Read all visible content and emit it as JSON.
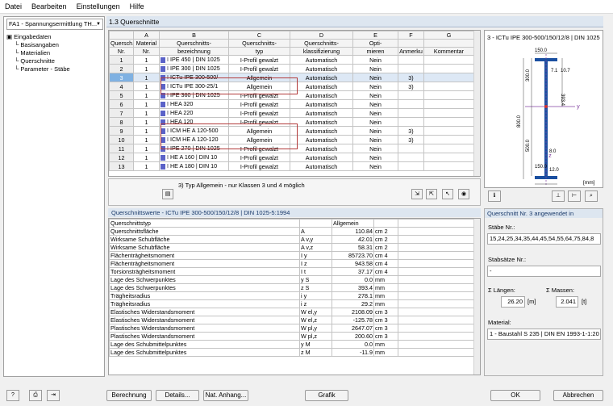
{
  "menu": [
    "Datei",
    "Bearbeiten",
    "Einstellungen",
    "Hilfe"
  ],
  "module_select": "FA1 - Spannungsermittlung TH...",
  "tree": [
    {
      "label": "Eingabedaten",
      "level": 0
    },
    {
      "label": "Basisangaben",
      "level": 1
    },
    {
      "label": "Materialien",
      "level": 1
    },
    {
      "label": "Querschnitte",
      "level": 1
    },
    {
      "label": "Parameter - Stäbe",
      "level": 1
    }
  ],
  "panel_title": "1.3 Querschnitte",
  "grid": {
    "letters": [
      "",
      "A",
      "B",
      "C",
      "D",
      "E",
      "F",
      "G"
    ],
    "headers": [
      [
        "Quersch.",
        "Nr."
      ],
      [
        "Material",
        "Nr."
      ],
      [
        "Querschnitts-",
        "bezeichnung"
      ],
      [
        "Querschnitts-",
        "typ"
      ],
      [
        "Querschnitts-",
        "klassifizierung"
      ],
      [
        "Opti-",
        "mieren"
      ],
      [
        "",
        "Anmerku"
      ],
      [
        "",
        "Kommentar"
      ]
    ],
    "rows": [
      {
        "nr": "1",
        "mat": "1",
        "name": "IPE 450 | DIN 1025",
        "typ": "I-Profil gewalzt",
        "kl": "Automatisch",
        "opt": "Nein",
        "anm": ""
      },
      {
        "nr": "2",
        "mat": "1",
        "name": "IPE 300 | DIN 1025",
        "typ": "I-Profil gewalzt",
        "kl": "Automatisch",
        "opt": "Nein",
        "anm": ""
      },
      {
        "nr": "3",
        "mat": "1",
        "name": "ICTu IPE 300-500/",
        "typ": "Allgemein",
        "kl": "Automatisch",
        "opt": "Nein",
        "anm": "3)"
      },
      {
        "nr": "4",
        "mat": "1",
        "name": "ICTu IPE 300-25/1",
        "typ": "Allgemein",
        "kl": "Automatisch",
        "opt": "Nein",
        "anm": "3)"
      },
      {
        "nr": "5",
        "mat": "1",
        "name": "IPE 360 | DIN 1025",
        "typ": "I-Profil gewalzt",
        "kl": "Automatisch",
        "opt": "Nein",
        "anm": ""
      },
      {
        "nr": "6",
        "mat": "1",
        "name": "HEA 320",
        "typ": "I-Profil gewalzt",
        "kl": "Automatisch",
        "opt": "Nein",
        "anm": ""
      },
      {
        "nr": "7",
        "mat": "1",
        "name": "HEA 220",
        "typ": "I-Profil gewalzt",
        "kl": "Automatisch",
        "opt": "Nein",
        "anm": ""
      },
      {
        "nr": "8",
        "mat": "1",
        "name": "HEA 120",
        "typ": "I-Profil gewalzt",
        "kl": "Automatisch",
        "opt": "Nein",
        "anm": ""
      },
      {
        "nr": "9",
        "mat": "1",
        "name": "ICM HE A 120-500",
        "typ": "Allgemein",
        "kl": "Automatisch",
        "opt": "Nein",
        "anm": "3)"
      },
      {
        "nr": "10",
        "mat": "1",
        "name": "ICM HE A 120-120",
        "typ": "Allgemein",
        "kl": "Automatisch",
        "opt": "Nein",
        "anm": "3)"
      },
      {
        "nr": "11",
        "mat": "1",
        "name": "IPE 270 | DIN 1025",
        "typ": "I-Profil gewalzt",
        "kl": "Automatisch",
        "opt": "Nein",
        "anm": ""
      },
      {
        "nr": "12",
        "mat": "1",
        "name": "HE A 160 | DIN 10",
        "typ": "I-Profil gewalzt",
        "kl": "Automatisch",
        "opt": "Nein",
        "anm": ""
      },
      {
        "nr": "13",
        "mat": "1",
        "name": "HE A 180 | DIN 10",
        "typ": "I-Profil gewalzt",
        "kl": "Automatisch",
        "opt": "Nein",
        "anm": ""
      }
    ]
  },
  "note": "3) Typ Allgemein - nur Klassen 3 und 4 möglich",
  "values_title": "Querschnittswerte  -  ICTu IPE 300-500/150/12/8 | DIN 1025-5:1994",
  "values": [
    {
      "name": "Querschnittstyp",
      "sym": "",
      "val": "Allgemein",
      "unit": ""
    },
    {
      "name": "Querschnittsfläche",
      "sym": "A",
      "val": "110.84",
      "unit": "cm 2"
    },
    {
      "name": "Wirksame Schubfläche",
      "sym": "A v,y",
      "val": "42.01",
      "unit": "cm 2"
    },
    {
      "name": "Wirksame Schubfläche",
      "sym": "A v,z",
      "val": "58.31",
      "unit": "cm 2"
    },
    {
      "name": "Flächenträgheitsmoment",
      "sym": "I y",
      "val": "85723.70",
      "unit": "cm 4"
    },
    {
      "name": "Flächenträgheitsmoment",
      "sym": "I z",
      "val": "943.58",
      "unit": "cm 4"
    },
    {
      "name": "Torsionsträgheitsmoment",
      "sym": "I t",
      "val": "37.17",
      "unit": "cm 4"
    },
    {
      "name": "Lage des Schwerpunktes",
      "sym": "y S",
      "val": "0.0",
      "unit": "mm"
    },
    {
      "name": "Lage des Schwerpunktes",
      "sym": "z S",
      "val": "393.4",
      "unit": "mm"
    },
    {
      "name": "Trägheitsradius",
      "sym": "i y",
      "val": "278.1",
      "unit": "mm"
    },
    {
      "name": "Trägheitsradius",
      "sym": "i z",
      "val": "29.2",
      "unit": "mm"
    },
    {
      "name": "Elastisches Widerstandsmoment",
      "sym": "W el,y",
      "val": "2108.09",
      "unit": "cm 3"
    },
    {
      "name": "Elastisches Widerstandsmoment",
      "sym": "W el,z",
      "val": "-125.78",
      "unit": "cm 3"
    },
    {
      "name": "Plastisches Widerstandsmoment",
      "sym": "W pl,y",
      "val": "2647.07",
      "unit": "cm 3"
    },
    {
      "name": "Plastisches Widerstandsmoment",
      "sym": "W pl,z",
      "val": "200.60",
      "unit": "cm 3"
    },
    {
      "name": "Lage des Schubmittelpunktes",
      "sym": "y M",
      "val": "0.0",
      "unit": "mm"
    },
    {
      "name": "Lage des Schubmittelpunktes",
      "sym": "z M",
      "val": "-11.9",
      "unit": "mm"
    }
  ],
  "preview": {
    "title": "3 - ICTu IPE 300-500/150/12/8 | DIN 1025",
    "unit": "[mm]",
    "dims": {
      "top_w": "150.0",
      "t1": "7.1",
      "d1": "10.7",
      "h1": "300.0",
      "h2": "393.4",
      "total": "800.0",
      "web_h": "500.0",
      "tw": "8.0",
      "t2": "12.0",
      "bot_w": "150.0"
    },
    "y": "y",
    "z": "z"
  },
  "used": {
    "title": "Querschnitt Nr. 3 angewendet in",
    "staebe_label": "Stäbe Nr.:",
    "staebe": "15,24,25,34,35,44,45,54,55,64,75,84,8",
    "saetze_label": "Stabsätze Nr.:",
    "saetze": "-",
    "laengen_label": "Σ Längen:",
    "laengen": "26.20",
    "laengen_unit": "[m]",
    "massen_label": "Σ Massen:",
    "massen": "2.041",
    "massen_unit": "[t]",
    "material_label": "Material:",
    "material": "1 - Baustahl S 235 | DIN EN 1993-1-1:20"
  },
  "buttons": {
    "berechnung": "Berechnung",
    "details": "Details...",
    "anhang": "Nat. Anhang...",
    "grafik": "Grafik",
    "ok": "OK",
    "abbrechen": "Abbrechen"
  }
}
